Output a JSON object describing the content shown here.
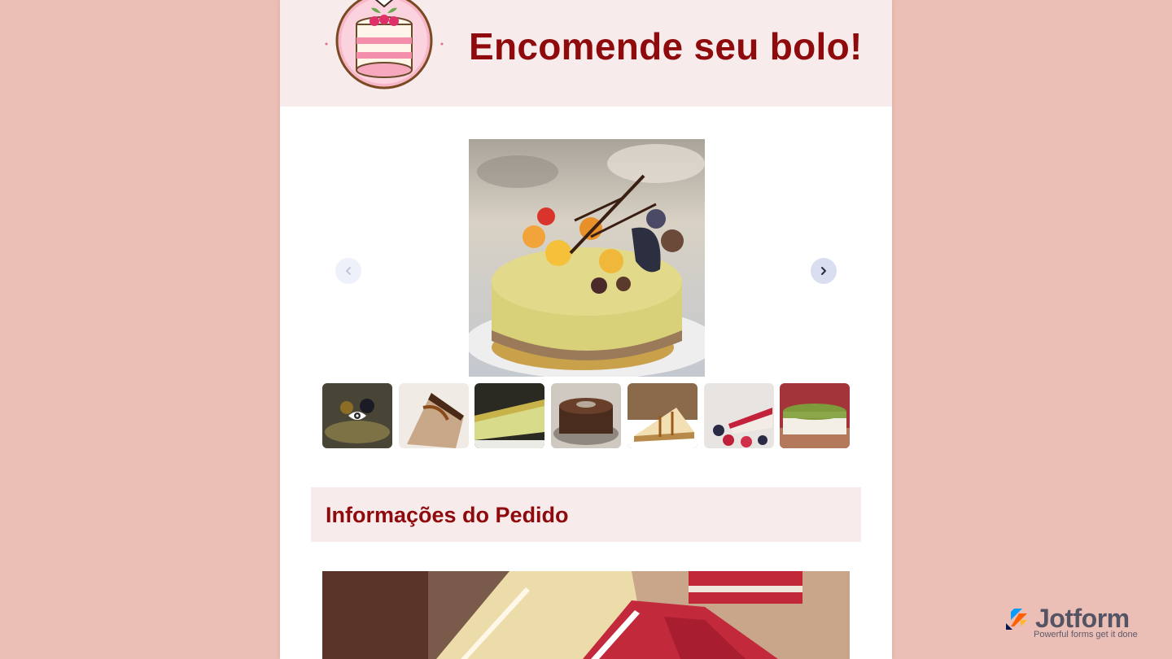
{
  "header": {
    "title": "Encomende seu bolo!",
    "logo_icon": "cake-logo-icon"
  },
  "gallery": {
    "main_image": "fruit-cheesecake-photo",
    "prev_icon": "chevron-left-icon",
    "next_icon": "chevron-right-icon",
    "selected_index": 0,
    "thumbnails": [
      {
        "name": "fruit-cheesecake-thumb",
        "selected": true
      },
      {
        "name": "chocolate-swirl-cheesecake-thumb"
      },
      {
        "name": "pistachio-cheesecake-slice-thumb"
      },
      {
        "name": "chocolate-cake-thumb"
      },
      {
        "name": "caramel-cheesecake-slice-thumb"
      },
      {
        "name": "berry-cheesecake-thumb"
      },
      {
        "name": "matcha-cheesecake-thumb"
      }
    ]
  },
  "section": {
    "title": "Informações do Pedido"
  },
  "badge": {
    "name": "Jotform",
    "tagline": "Powerful forms get it done"
  },
  "colors": {
    "page_background": "#ebbfb6",
    "header_background": "#f7eceb",
    "title_color": "#8e0a0d"
  }
}
